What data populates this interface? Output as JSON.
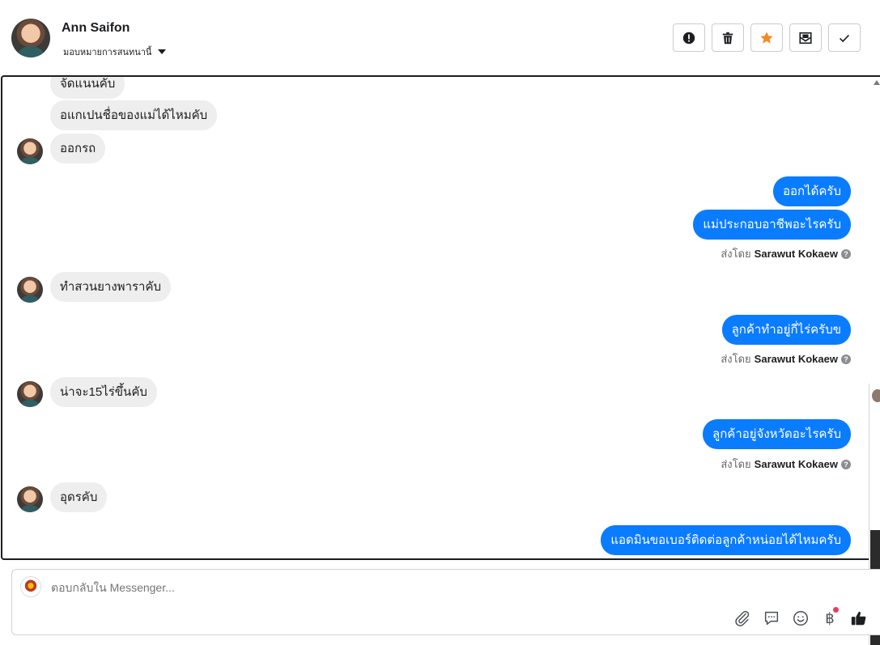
{
  "header": {
    "contact_name": "Ann Saifon",
    "assign_label": "มอบหมายการสนทนานี้",
    "actions": [
      {
        "name": "mark-spam-button",
        "icon": "alert-circle-icon"
      },
      {
        "name": "delete-button",
        "icon": "trash-icon"
      },
      {
        "name": "star-button",
        "icon": "star-icon"
      },
      {
        "name": "mark-unread-button",
        "icon": "envelope-icon"
      },
      {
        "name": "mark-done-button",
        "icon": "check-icon"
      }
    ]
  },
  "messages": {
    "m1": "จัดแนนคับ",
    "m2": "อแกเปนชื่อของแม่ได้ไหมคับ",
    "m3": "ออกรถ",
    "m4": "ออกได้ครับ",
    "m5": "แม่ประกอบอาชีพอะไรครับ",
    "m6": "ทำสวนยางพาราคับ",
    "m7": "ลูกค้าทำอยู่กี่ไร่ครับข",
    "m8": "น่าจะ15ไร่ขึ้นคับ",
    "m9": "ลูกค้าอยู่จังหวัดอะไรครับ",
    "m10": "อุดรคับ",
    "m11": "แอดมินขอเบอร์ติดต่อลูกค้าหน่อยได้ไหมครับ"
  },
  "sent_by": {
    "prefix": "ส่งโดย",
    "agent": "Sarawut Kokaew",
    "help": "?"
  },
  "composer": {
    "placeholder": "ตอบกลับใน Messenger..."
  },
  "tools": {
    "currency_symbol": "฿"
  },
  "colors": {
    "outgoing_bubble": "#0a7cff",
    "incoming_bubble": "#eeeeee",
    "star": "#f28b20"
  }
}
